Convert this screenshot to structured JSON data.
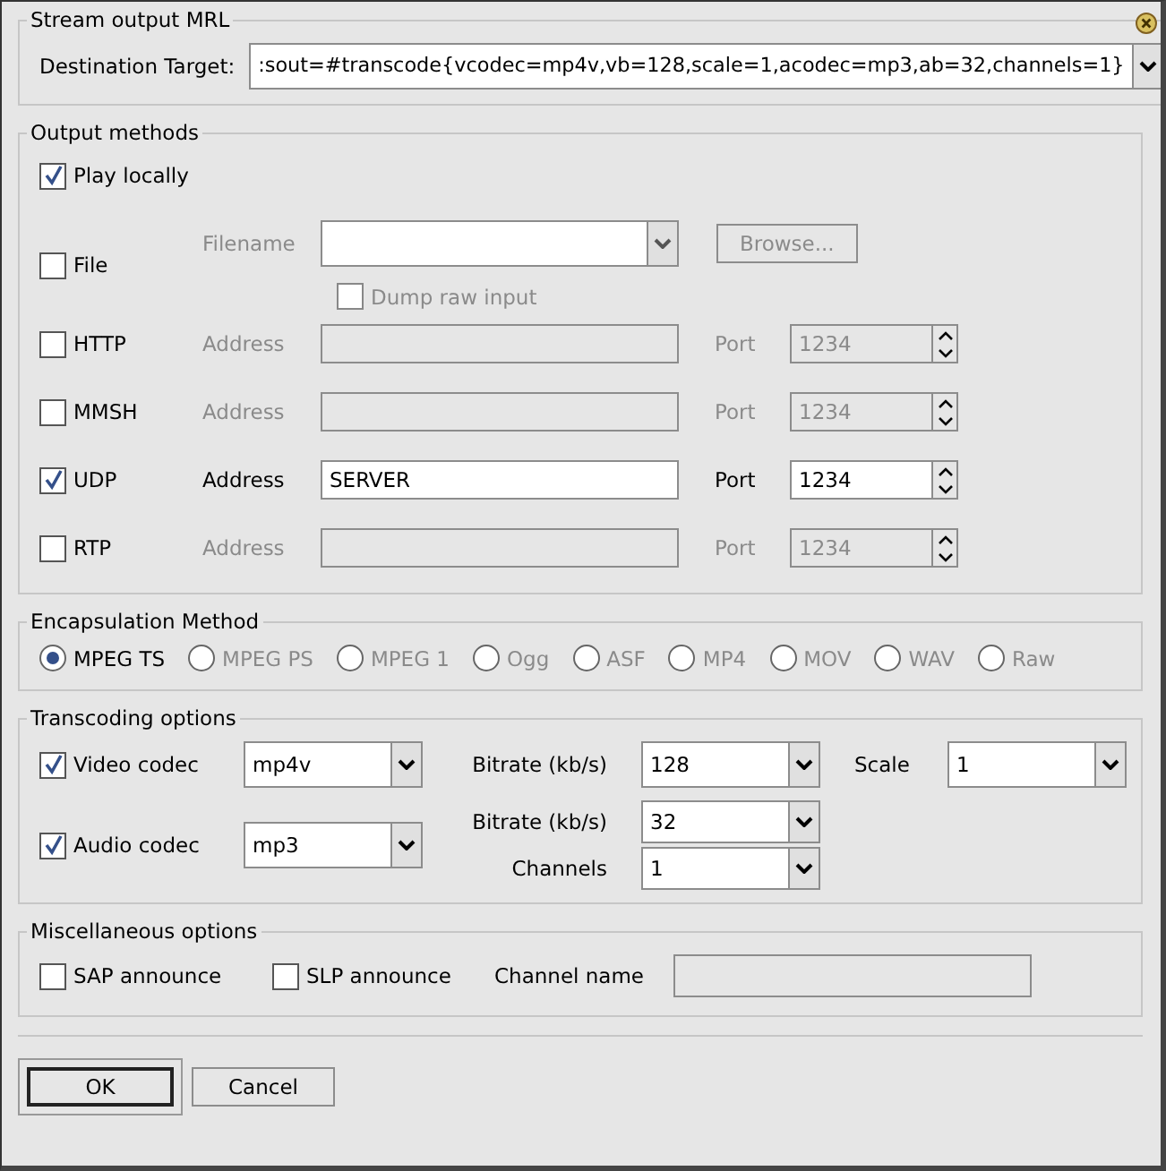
{
  "mrl": {
    "legend": "Stream output MRL",
    "label": "Destination Target:",
    "value": ":sout=#transcode{vcodec=mp4v,vb=128,scale=1,acodec=mp3,ab=32,channels=1}"
  },
  "output": {
    "legend": "Output methods",
    "play_locally": {
      "label": "Play locally",
      "checked": true
    },
    "file": {
      "label": "File",
      "checked": false,
      "filename_label": "Filename",
      "browse": "Browse...",
      "dump": {
        "label": "Dump raw input",
        "checked": false
      }
    },
    "methods": [
      {
        "label": "HTTP",
        "checked": false,
        "address_label": "Address",
        "port_label": "Port",
        "port": "1234"
      },
      {
        "label": "MMSH",
        "checked": false,
        "address_label": "Address",
        "port_label": "Port",
        "port": "1234"
      },
      {
        "label": "UDP",
        "checked": true,
        "address_label": "Address",
        "address": "SERVER",
        "port_label": "Port",
        "port": "1234"
      },
      {
        "label": "RTP",
        "checked": false,
        "address_label": "Address",
        "port_label": "Port",
        "port": "1234"
      }
    ]
  },
  "encapsulation": {
    "legend": "Encapsulation Method",
    "options": [
      {
        "label": "MPEG TS",
        "selected": true,
        "disabled": false
      },
      {
        "label": "MPEG PS",
        "selected": false,
        "disabled": true
      },
      {
        "label": "MPEG 1",
        "selected": false,
        "disabled": true
      },
      {
        "label": "Ogg",
        "selected": false,
        "disabled": true
      },
      {
        "label": "ASF",
        "selected": false,
        "disabled": true
      },
      {
        "label": "MP4",
        "selected": false,
        "disabled": true
      },
      {
        "label": "MOV",
        "selected": false,
        "disabled": true
      },
      {
        "label": "WAV",
        "selected": false,
        "disabled": true
      },
      {
        "label": "Raw",
        "selected": false,
        "disabled": true
      }
    ]
  },
  "transcoding": {
    "legend": "Transcoding options",
    "video": {
      "label": "Video codec",
      "checked": true,
      "codec": "mp4v",
      "bitrate_label": "Bitrate (kb/s)",
      "bitrate": "128",
      "scale_label": "Scale",
      "scale": "1"
    },
    "audio": {
      "label": "Audio codec",
      "checked": true,
      "codec": "mp3",
      "bitrate_label": "Bitrate (kb/s)",
      "bitrate": "32",
      "channels_label": "Channels",
      "channels": "1"
    }
  },
  "misc": {
    "legend": "Miscellaneous options",
    "sap": {
      "label": "SAP announce",
      "checked": false
    },
    "slp": {
      "label": "SLP announce",
      "checked": false
    },
    "channel_label": "Channel name"
  },
  "buttons": [
    {
      "label": "OK",
      "default": true
    },
    {
      "label": "Cancel",
      "default": false
    }
  ]
}
